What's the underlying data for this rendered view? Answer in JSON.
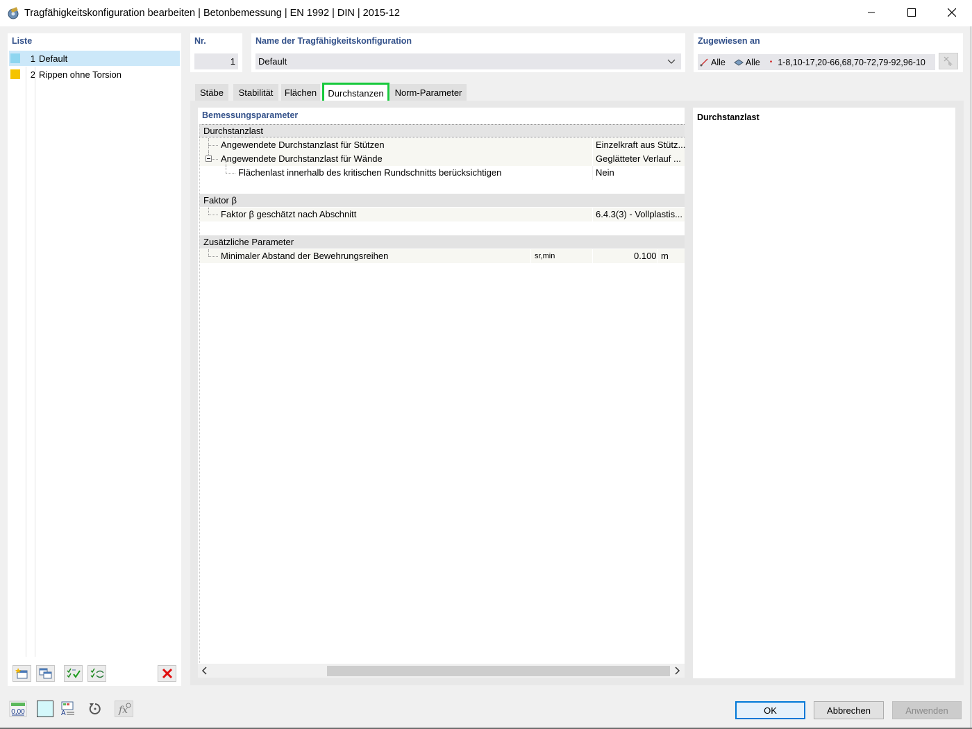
{
  "window": {
    "title": "Tragfähigkeitskonfiguration bearbeiten | Betonbemessung | EN 1992 | DIN | 2015-12"
  },
  "list": {
    "label": "Liste",
    "items": [
      {
        "num": "1",
        "name": "Default",
        "color": "#8ed6f0",
        "selected": true
      },
      {
        "num": "2",
        "name": "Rippen ohne Torsion",
        "color": "#f5c400",
        "selected": false
      }
    ]
  },
  "nr": {
    "label": "Nr.",
    "value": "1"
  },
  "name": {
    "label": "Name der Tragfähigkeitskonfiguration",
    "value": "Default"
  },
  "assigned": {
    "label": "Zugewiesen an",
    "members": "Alle",
    "member_sets": "Alle",
    "surfaces": "1-8,10-17,20-66,68,70-72,79-92,96-10"
  },
  "tabs": [
    {
      "label": "Stäbe",
      "active": false
    },
    {
      "label": "Stabilität",
      "active": false
    },
    {
      "label": "Flächen",
      "active": false
    },
    {
      "label": "Durchstanzen",
      "active": true
    },
    {
      "label": "Norm-Parameter",
      "active": false
    }
  ],
  "grid": {
    "heading": "Bemessungsparameter",
    "groups": {
      "g1": "Durchstanzlast",
      "g2": "Faktor β",
      "g3": "Zusätzliche Parameter"
    },
    "rows": {
      "r1": {
        "label": "Angewendete Durchstanzlast für Stützen",
        "value": "Einzelkraft aus Stütz..."
      },
      "r2": {
        "label": "Angewendete Durchstanzlast für Wände",
        "value": "Geglätteter Verlauf ..."
      },
      "r3": {
        "label": "Flächenlast innerhalb des kritischen Rundschnitts berücksichtigen",
        "value": "Nein"
      },
      "r4": {
        "label": "Faktor β geschätzt nach Abschnitt",
        "value": "6.4.3(3) - Vollplastis..."
      },
      "r5": {
        "label": "Minimaler Abstand der Bewehrungsreihen",
        "symbol": "sr,min",
        "value": "0.100",
        "unit": "m"
      }
    }
  },
  "description": {
    "title": "Durchstanzlast"
  },
  "buttons": {
    "ok": "OK",
    "cancel": "Abbrechen",
    "apply": "Anwenden"
  },
  "bottom_icons": {
    "units": "0,00"
  }
}
